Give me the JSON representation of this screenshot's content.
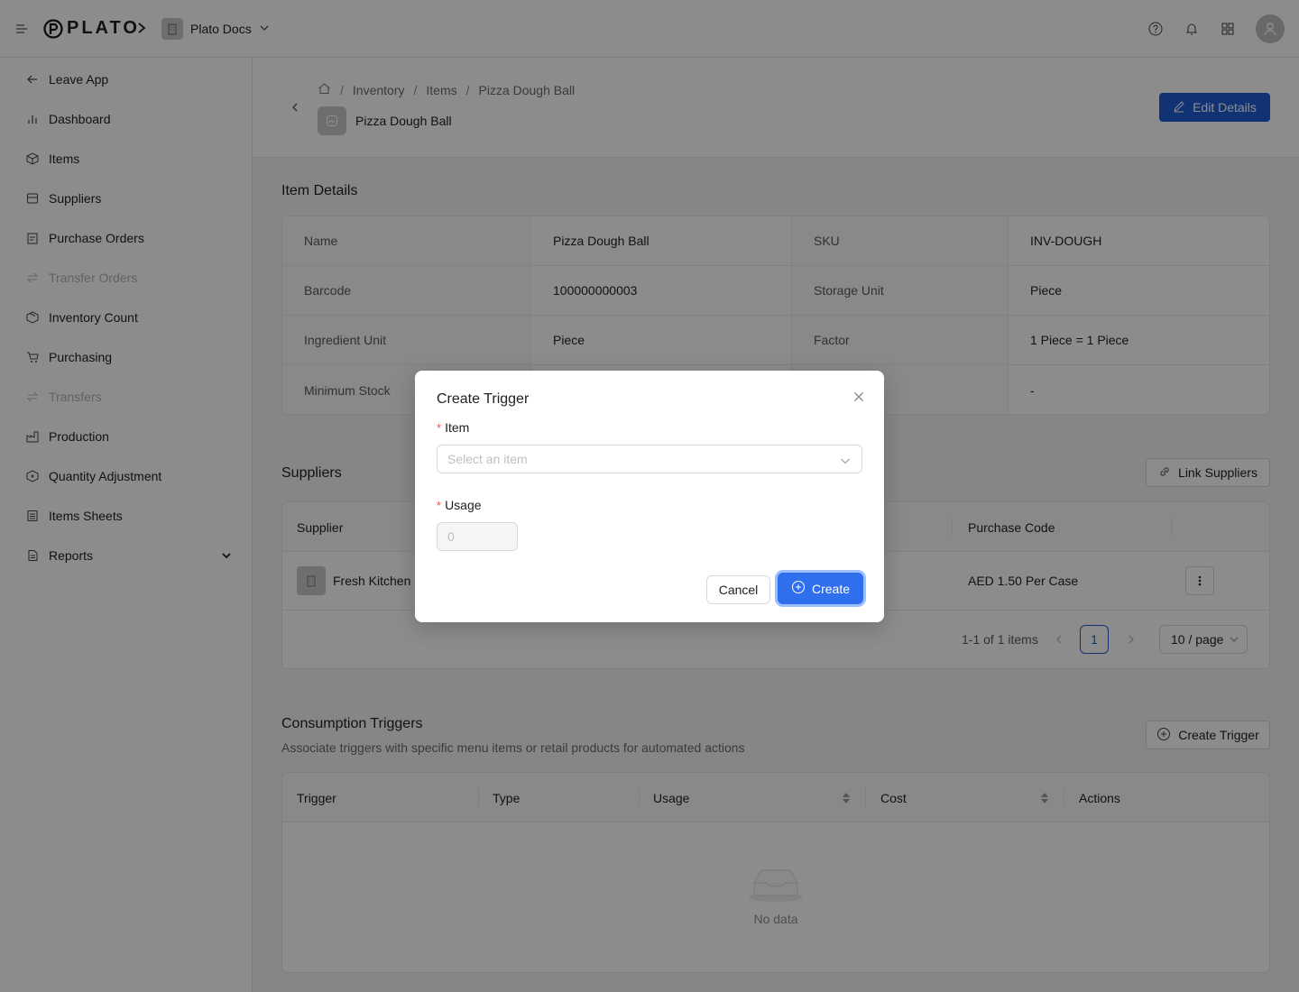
{
  "topbar": {
    "brand": "PLATO",
    "org_name": "Plato Docs",
    "icons": [
      "help-icon",
      "bell-icon",
      "apps-grid-icon",
      "avatar-icon"
    ]
  },
  "sidebar": {
    "items": [
      {
        "label": "Leave App",
        "icon": "arrow-left-icon",
        "disabled": false
      },
      {
        "label": "Dashboard",
        "icon": "bar-chart-icon",
        "disabled": false
      },
      {
        "label": "Items",
        "icon": "box-icon",
        "disabled": false
      },
      {
        "label": "Suppliers",
        "icon": "store-icon",
        "disabled": false
      },
      {
        "label": "Purchase Orders",
        "icon": "clipboard-icon",
        "disabled": false
      },
      {
        "label": "Transfer Orders",
        "icon": "transfer-icon",
        "disabled": true
      },
      {
        "label": "Inventory Count",
        "icon": "boxes-icon",
        "disabled": false
      },
      {
        "label": "Purchasing",
        "icon": "cart-icon",
        "disabled": false
      },
      {
        "label": "Transfers",
        "icon": "transfer-icon",
        "disabled": true
      },
      {
        "label": "Production",
        "icon": "factory-icon",
        "disabled": false
      },
      {
        "label": "Quantity Adjustment",
        "icon": "adjust-icon",
        "disabled": false
      },
      {
        "label": "Items Sheets",
        "icon": "sheet-icon",
        "disabled": false
      },
      {
        "label": "Reports",
        "icon": "report-icon",
        "disabled": false
      }
    ]
  },
  "breadcrumb": [
    "Inventory",
    "Items",
    "Pizza Dough Ball"
  ],
  "page_title": "Pizza Dough Ball",
  "edit_button": "Edit Details",
  "item_details": {
    "title": "Item Details",
    "rows": [
      [
        "Name",
        "Pizza Dough Ball",
        "SKU",
        "INV-DOUGH"
      ],
      [
        "Barcode",
        "100000000003",
        "Storage Unit",
        "Piece"
      ],
      [
        "Ingredient Unit",
        "Piece",
        "Factor",
        "1 Piece = 1 Piece"
      ],
      [
        "Minimum Stock",
        "",
        "",
        "-"
      ]
    ]
  },
  "suppliers": {
    "title": "Suppliers",
    "link_button": "Link Suppliers",
    "columns": [
      "Supplier",
      "Purchase Code"
    ],
    "rows": [
      {
        "name": "Fresh Kitchen S",
        "purchase_code": "AED 1.50 Per Case"
      }
    ],
    "pagination": {
      "summary": "1-1 of 1 items",
      "current_page": "1",
      "page_size": "10 / page"
    }
  },
  "triggers": {
    "title": "Consumption Triggers",
    "subtitle": "Associate triggers with specific menu items or retail products for automated actions",
    "create_button": "Create Trigger",
    "columns": [
      "Trigger",
      "Type",
      "Usage",
      "Cost",
      "Actions"
    ],
    "empty_text": "No data"
  },
  "modal": {
    "title": "Create Trigger",
    "item_label": "Item",
    "item_placeholder": "Select an item",
    "usage_label": "Usage",
    "usage_placeholder": "0",
    "cancel_label": "Cancel",
    "create_label": "Create"
  }
}
